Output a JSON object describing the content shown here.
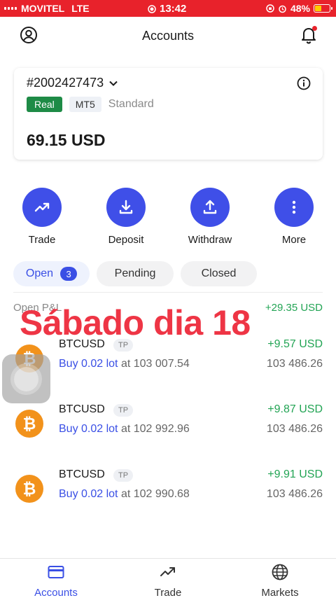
{
  "status_bar": {
    "carrier": "MOVITEL",
    "network": "LTE",
    "time": "13:42",
    "battery_percent": "48%",
    "battery_level": 0.48,
    "bar_color": "#e8222b"
  },
  "header": {
    "title": "Accounts",
    "profile_icon": "user-circle-icon",
    "notification_icon": "bell-icon"
  },
  "account": {
    "number": "#2002427473",
    "type_badge": "Real",
    "platform_badge": "MT5",
    "account_kind": "Standard",
    "balance": "69.15 USD"
  },
  "actions": [
    {
      "label": "Trade",
      "icon": "trend-up-icon"
    },
    {
      "label": "Deposit",
      "icon": "download-icon"
    },
    {
      "label": "Withdraw",
      "icon": "upload-icon"
    },
    {
      "label": "More",
      "icon": "more-vertical-icon"
    }
  ],
  "tabs": [
    {
      "label": "Open",
      "count": "3",
      "active": true
    },
    {
      "label": "Pending",
      "active": false
    },
    {
      "label": "Closed",
      "active": false
    }
  ],
  "pnl": {
    "label": "Open P&L",
    "value": "+29.35 USD"
  },
  "positions": [
    {
      "symbol": "BTCUSD",
      "tag": "TP",
      "profit": "+9.57 USD",
      "side_lot": "Buy 0.02 lot",
      "at_text": "at",
      "open_price": "103 007.54",
      "current_price": "103 486.26"
    },
    {
      "symbol": "BTCUSD",
      "tag": "TP",
      "profit": "+9.87 USD",
      "side_lot": "Buy 0.02 lot",
      "at_text": "at",
      "open_price": "102 992.96",
      "current_price": "103 486.26"
    },
    {
      "symbol": "BTCUSD",
      "tag": "TP",
      "profit": "+9.91 USD",
      "side_lot": "Buy 0.02 lot",
      "at_text": "at",
      "open_price": "102 990.68",
      "current_price": "103 486.26"
    }
  ],
  "overlay_text": "Sábado dia 18",
  "bottom_nav": [
    {
      "label": "Accounts",
      "icon": "card-icon",
      "active": true
    },
    {
      "label": "Trade",
      "icon": "trend-up-icon",
      "active": false
    },
    {
      "label": "Markets",
      "icon": "globe-icon",
      "active": false
    }
  ],
  "colors": {
    "accent": "#3f4fe8",
    "profit": "#22a454",
    "real_badge": "#1e8b46",
    "overlay": "#ee3545",
    "bitcoin": "#f2921b"
  }
}
